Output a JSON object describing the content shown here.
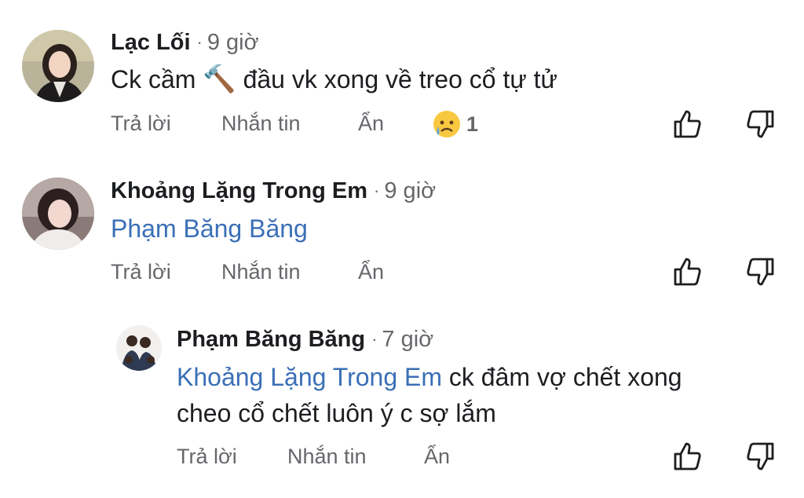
{
  "comments": [
    {
      "author": "Lạc Lối",
      "time": "9 giờ",
      "body": "Ck cầm",
      "emoji": "🔨",
      "body_after": "đầu vk xong về treo cổ tự tử",
      "actions": {
        "reply": "Trả lời",
        "message": "Nhắn tin",
        "hide": "Ẩn"
      },
      "reaction": {
        "icon": "crying-face-icon",
        "count": "1"
      }
    },
    {
      "author": "Khoảng Lặng Trong Em",
      "time": "9 giờ",
      "mention": "Phạm Băng Băng",
      "actions": {
        "reply": "Trả lời",
        "message": "Nhắn tin",
        "hide": "Ẩn"
      }
    },
    {
      "author": "Phạm Băng Băng",
      "time": "7 giờ",
      "mention": "Khoảng Lặng Trong Em",
      "body_line1": "ck đâm vợ chết xong",
      "body_line2": "cheo cổ chết luôn ý c sợ lắm",
      "actions": {
        "reply": "Trả lời",
        "message": "Nhắn tin",
        "hide": "Ẩn"
      }
    }
  ],
  "icons": {
    "like": "thumbs-up-icon",
    "dislike": "thumbs-down-icon"
  },
  "colors": {
    "mention": "#3a6fb6",
    "secondary_text": "#65676b"
  }
}
